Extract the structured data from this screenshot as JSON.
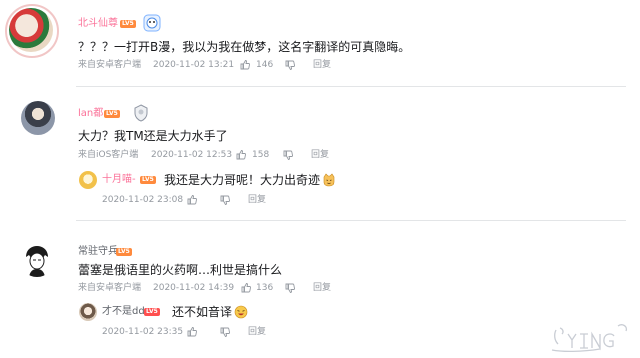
{
  "comments": [
    {
      "user": "北斗仙尊",
      "level": "LV5",
      "text": "？？？一打开B漫，我以为我在做梦，这名字翻译的可真隐晦。",
      "source": "来自安卓客户端",
      "time": "2020-11-02 13:21",
      "likes": "146",
      "reply": "回复"
    },
    {
      "user": "lan都",
      "level": "LV5",
      "text": "大力？我TM还是大力水手了",
      "source": "来自iOS客户端",
      "time": "2020-11-02 12:53",
      "likes": "158",
      "reply": "回复",
      "sub": {
        "user": "十月喵-",
        "level": "LV5",
        "text": "我还是大力哥呢！大力出奇迹",
        "time": "2020-11-02 23:08",
        "reply": "回复"
      }
    },
    {
      "user": "常驻守兵",
      "level": "LV5",
      "text": "蕾塞是俄语里的火药啊…利世是搞什么",
      "source": "来自安卓客户端",
      "time": "2020-11-02 14:39",
      "likes": "136",
      "reply": "回复",
      "sub": {
        "user": "才不是dd",
        "level": "LV5",
        "text": "还不如音译",
        "time": "2020-11-02 23:35",
        "reply": "回复"
      }
    }
  ],
  "colors": {
    "pink": "#fb7299",
    "gray": "#9499a0",
    "level": "#ff8a3d",
    "divider": "#e3e5e7"
  },
  "icons": [
    "thumbs-up-icon",
    "thumbs-down-icon",
    "laugh-emoji-icon",
    "smug-emoji-icon"
  ]
}
